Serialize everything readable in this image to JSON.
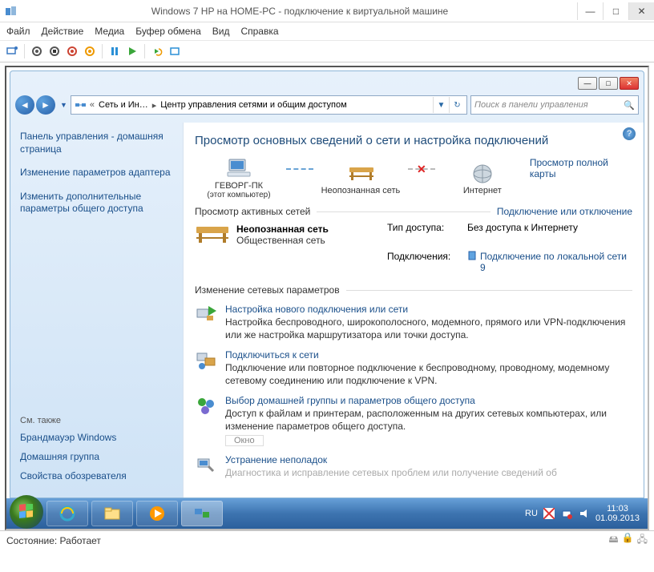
{
  "host": {
    "title": "Windows 7 HP на HOME-PC - подключение к виртуальной машине",
    "menu": [
      "Файл",
      "Действие",
      "Медиа",
      "Буфер обмена",
      "Вид",
      "Справка"
    ]
  },
  "win": {
    "buttons": {
      "min": "—",
      "max": "□",
      "close": "✕"
    }
  },
  "nav": {
    "crumb1": "Сеть и Ин…",
    "crumb2": "Центр управления сетями и общим доступом",
    "search_placeholder": "Поиск в панели управления"
  },
  "sidebar": {
    "items": [
      "Панель управления - домашняя страница",
      "Изменение параметров адаптера",
      "Изменить дополнительные параметры общего доступа"
    ],
    "see_also": "См. также",
    "links": [
      "Брандмауэр Windows",
      "Домашняя группа",
      "Свойства обозревателя"
    ]
  },
  "content": {
    "heading": "Просмотр основных сведений о сети и настройка подключений",
    "map": {
      "pc": "ГЕВОРГ-ПК",
      "pc_sub": "(этот компьютер)",
      "net": "Неопознанная сеть",
      "internet": "Интернет",
      "full_map": "Просмотр полной карты"
    },
    "active_title": "Просмотр активных сетей",
    "connect_link": "Подключение или отключение",
    "network": {
      "name": "Неопознанная сеть",
      "type": "Общественная сеть",
      "access_label": "Тип доступа:",
      "access_value": "Без доступа к Интернету",
      "conn_label": "Подключения:",
      "conn_value": "Подключение по локальной сети 9"
    },
    "change_title": "Изменение сетевых параметров",
    "options": [
      {
        "title": "Настройка нового подключения или сети",
        "desc": "Настройка беспроводного, широкополосного, модемного, прямого или VPN-подключения или же настройка маршрутизатора или точки доступа."
      },
      {
        "title": "Подключиться к сети",
        "desc": "Подключение или повторное подключение к беспроводному, проводному, модемному сетевому соединению или подключение к VPN."
      },
      {
        "title": "Выбор домашней группы и параметров общего доступа",
        "desc": "Доступ к файлам и принтерам, расположенным на других сетевых компьютерах, или изменение параметров общего доступа."
      },
      {
        "title": "Устранение неполадок",
        "desc": "Диагностика и исправление сетевых проблем или получение сведений об"
      }
    ],
    "okno": "Окно"
  },
  "taskbar": {
    "lang": "RU",
    "time": "11:03",
    "date": "01.09.2013"
  },
  "footer": {
    "status": "Состояние: Работает"
  }
}
